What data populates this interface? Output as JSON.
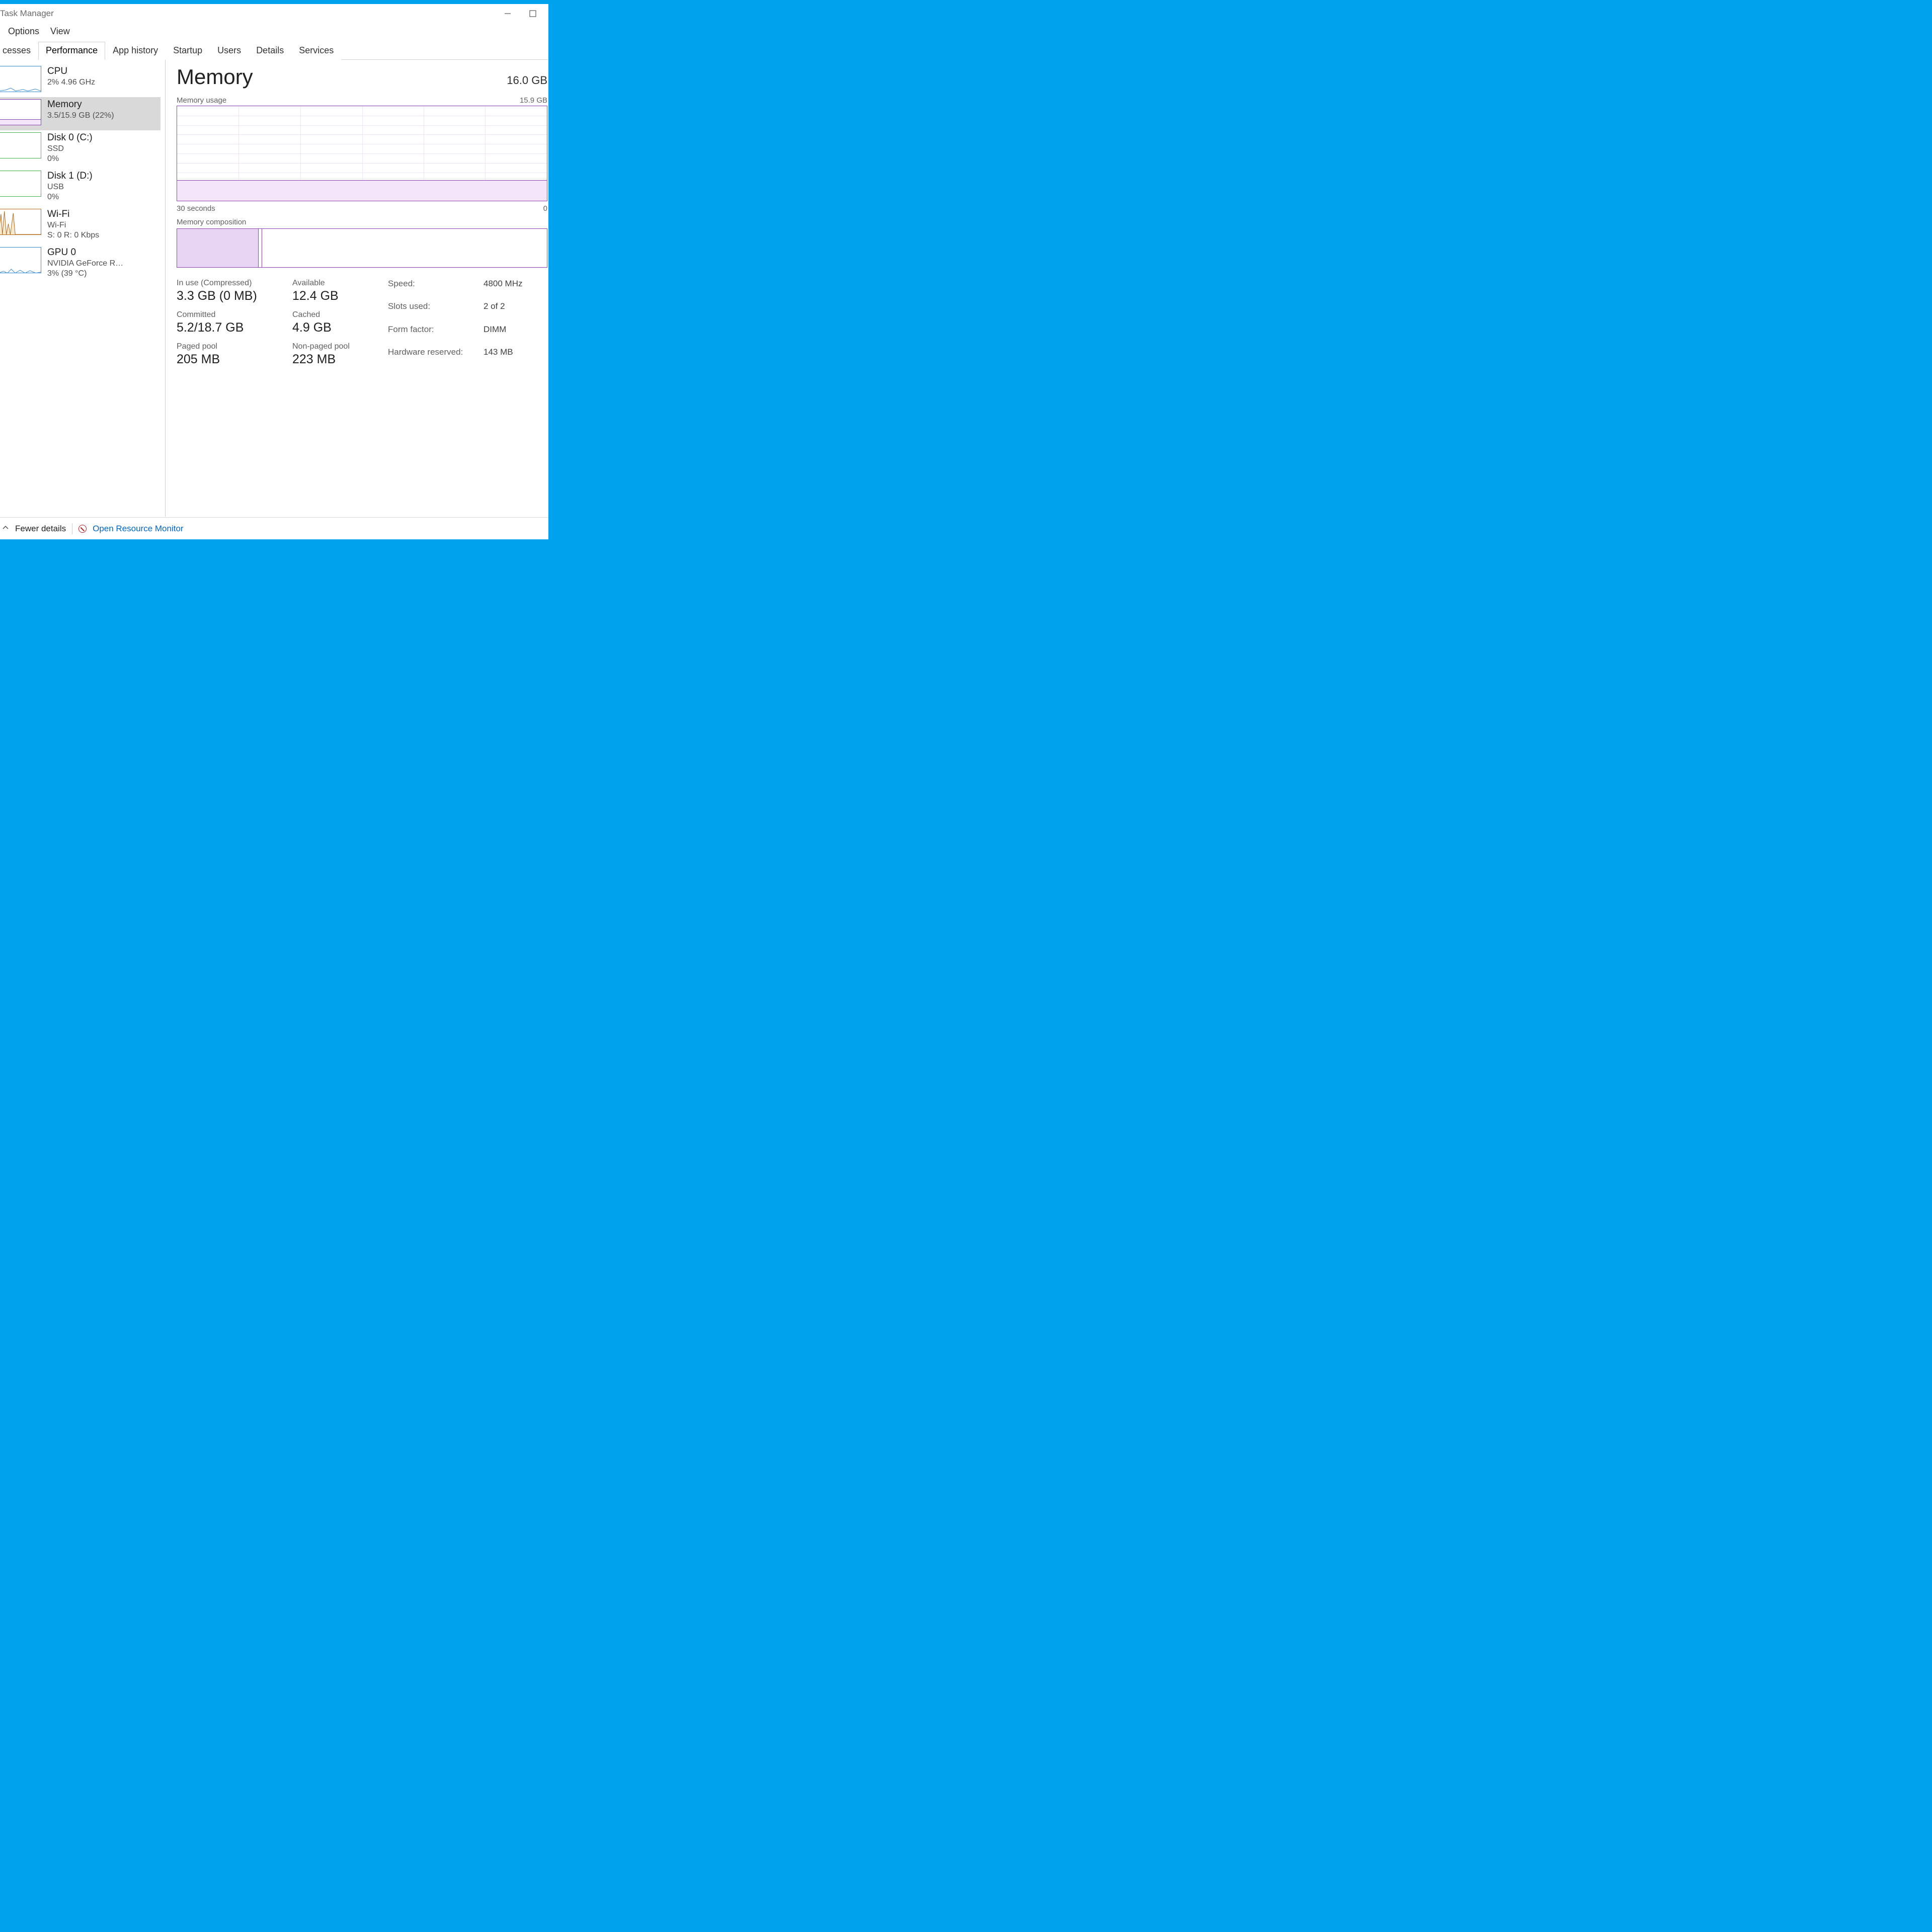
{
  "window": {
    "title": "Task Manager"
  },
  "menu": {
    "options": "Options",
    "view": "View"
  },
  "tabs": [
    {
      "label": "cesses"
    },
    {
      "label": "Performance",
      "active": true
    },
    {
      "label": "App history"
    },
    {
      "label": "Startup"
    },
    {
      "label": "Users"
    },
    {
      "label": "Details"
    },
    {
      "label": "Services"
    }
  ],
  "sidebar": {
    "cpu": {
      "title": "CPU",
      "sub": "2%  4.96 GHz"
    },
    "memory": {
      "title": "Memory",
      "sub": "3.5/15.9 GB (22%)"
    },
    "disk0": {
      "title": "Disk 0 (C:)",
      "sub1": "SSD",
      "sub2": "0%"
    },
    "disk1": {
      "title": "Disk 1 (D:)",
      "sub1": "USB",
      "sub2": "0%"
    },
    "wifi": {
      "title": "Wi-Fi",
      "sub1": "Wi-Fi",
      "sub2": "S: 0  R: 0 Kbps"
    },
    "gpu": {
      "title": "GPU 0",
      "sub1": "NVIDIA GeForce R…",
      "sub2": "3% (39 °C)"
    }
  },
  "main": {
    "heading": "Memory",
    "total": "16.0 GB",
    "usage_label": "Memory usage",
    "usage_max": "15.9 GB",
    "time_left": "30 seconds",
    "time_right": "0",
    "comp_label": "Memory composition",
    "stats": {
      "in_use_lab": "In use (Compressed)",
      "in_use_val": "3.3 GB (0 MB)",
      "available_lab": "Available",
      "available_val": "12.4 GB",
      "committed_lab": "Committed",
      "committed_val": "5.2/18.7 GB",
      "cached_lab": "Cached",
      "cached_val": "4.9 GB",
      "paged_lab": "Paged pool",
      "paged_val": "205 MB",
      "nonpaged_lab": "Non-paged pool",
      "nonpaged_val": "223 MB"
    },
    "hw": {
      "speed_lab": "Speed:",
      "speed_val": "4800 MHz",
      "slots_lab": "Slots used:",
      "slots_val": "2 of 2",
      "form_lab": "Form factor:",
      "form_val": "DIMM",
      "hwres_lab": "Hardware reserved:",
      "hwres_val": "143 MB"
    }
  },
  "bottom": {
    "fewer": "Fewer details",
    "resmon": "Open Resource Monitor"
  },
  "chart_data": {
    "type": "area",
    "title": "Memory usage",
    "xlabel": "seconds",
    "ylabel": "GB",
    "xlim": [
      0,
      30
    ],
    "ylim": [
      0,
      15.9
    ],
    "x": [
      0,
      5,
      10,
      15,
      20,
      25,
      30
    ],
    "values": [
      3.5,
      3.5,
      3.5,
      3.5,
      3.5,
      3.5,
      3.5
    ]
  }
}
